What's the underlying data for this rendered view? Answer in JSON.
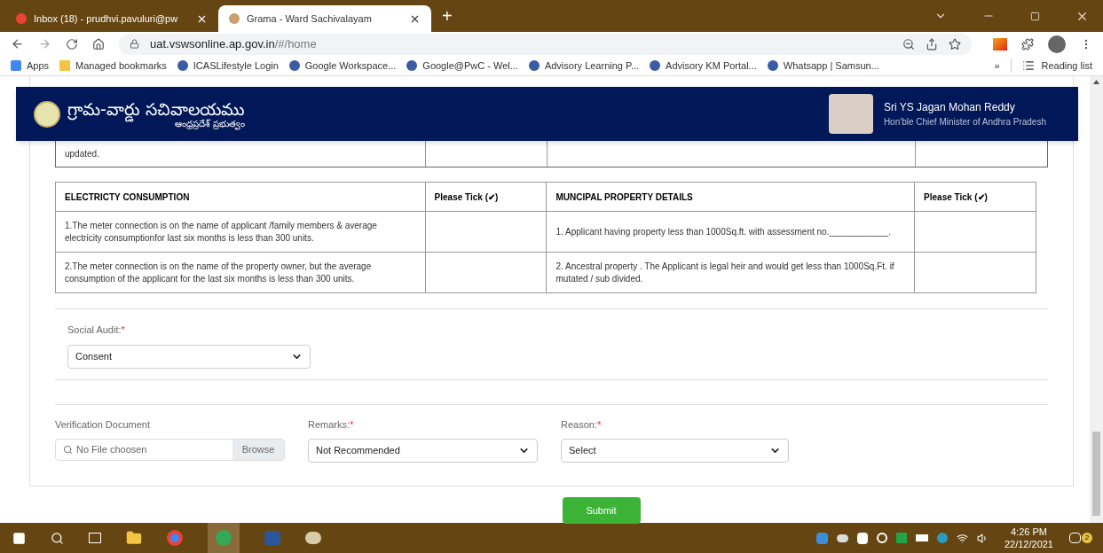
{
  "browser": {
    "tabs": [
      {
        "title": "Inbox (18) - prudhvi.pavuluri@pw",
        "selected": false
      },
      {
        "title": "Grama - Ward Sachivalayam",
        "selected": true
      }
    ],
    "new_tab": "+",
    "url": {
      "host": "uat.vswsonline.ap.gov.in",
      "path": "/#/home"
    },
    "bookmarks": [
      "Apps",
      "Managed bookmarks",
      "ICASLifestyle Login",
      "Google Workspace...",
      "Google@PwC - Wel...",
      "Advisory Learning P...",
      "Advisory KM Portal...",
      "Whatsapp | Samsun..."
    ],
    "more": "»",
    "reading_list": "Reading list"
  },
  "header": {
    "title": "గ్రామ-వార్డు సచివాలయము",
    "subtitle": "ఆంధ్రప్రదేశ్ ప్రభుత్వం",
    "person_name": "Sri YS Jagan Mohan Reddy",
    "person_role": "Hon'ble Chief Minister of Andhra Pradesh"
  },
  "previous_table_tail": "updated.",
  "table": {
    "columns": [
      "ELECTRICTY CONSUMPTION",
      "Please Tick (✔)",
      "MUNCIPAL PROPERTY DETAILS",
      "Please Tick (✔)"
    ],
    "rows": [
      [
        "1.The meter connection is on the name of applicant /family members & average electricity consumptionfor last six months is less than 300 units.",
        "",
        "1. Applicant having property less than 1000Sq.ft. with assessment no.____________.",
        ""
      ],
      [
        "2.The meter connection is on the name of the property owner, but the average consumption of the applicant for the last six months is less than 300 units.",
        "",
        "2. Ancestral property . The Applicant is legal heir and would get less than 1000Sq.Ft. if mutated / sub divided.",
        ""
      ]
    ]
  },
  "social_audit": {
    "label": "Social Audit:",
    "required_mark": "*",
    "value": "Consent"
  },
  "verification_document": {
    "label": "Verification Document",
    "placeholder": "No File choosen",
    "button": "Browse"
  },
  "remarks": {
    "label": "Remarks:",
    "required_mark": "*",
    "value": "Not Recommended"
  },
  "reason": {
    "label": "Reason:",
    "required_mark": "*",
    "value": "Select"
  },
  "submit": "Submit",
  "taskbar": {
    "time": "4:26 PM",
    "date": "22/12/2021",
    "notifications": "2"
  }
}
